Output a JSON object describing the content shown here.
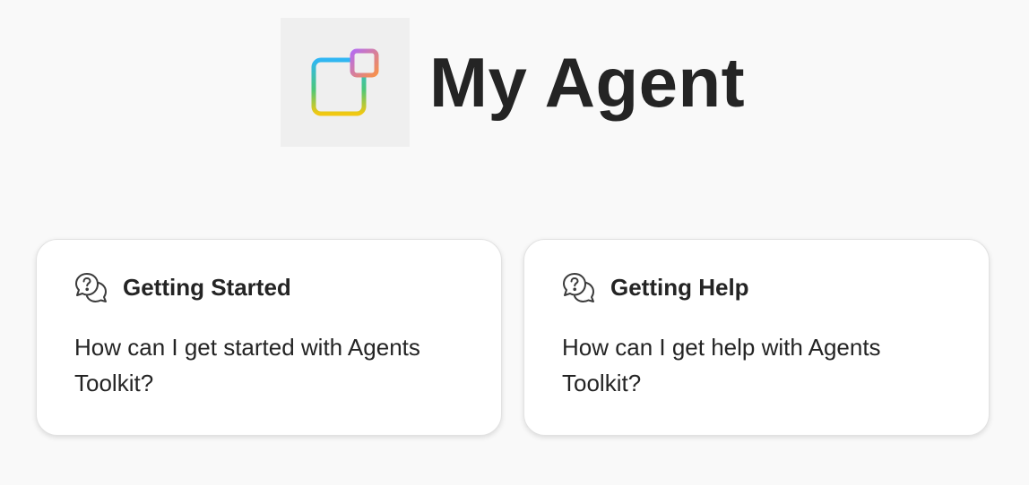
{
  "agent": {
    "title": "My Agent",
    "logo_icon": "agent-app-icon"
  },
  "starters": [
    {
      "icon": "chat-question-icon",
      "title": "Getting Started",
      "prompt": "How can I get started with Agents Toolkit?"
    },
    {
      "icon": "chat-question-icon",
      "title": "Getting Help",
      "prompt": "How can I get help with Agents Toolkit?"
    }
  ]
}
